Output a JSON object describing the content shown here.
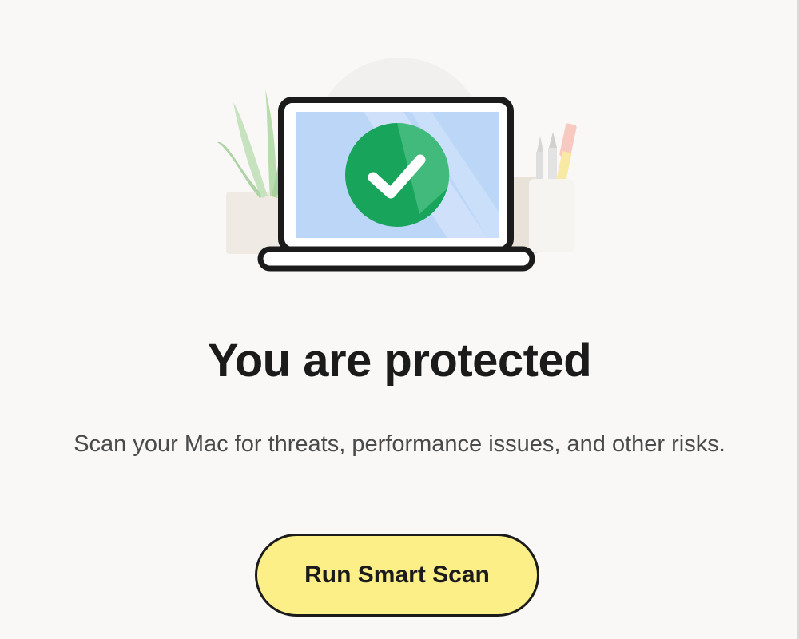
{
  "status": {
    "title": "You are protected",
    "description": "Scan your Mac for threats, performance issues, and other risks."
  },
  "actions": {
    "run_scan_label": "Run Smart Scan"
  },
  "illustration": {
    "icon": "checkmark-icon",
    "colors": {
      "check_green": "#18a45a",
      "screen_blue": "#bcd6f7",
      "button_yellow": "#fcef88"
    }
  }
}
